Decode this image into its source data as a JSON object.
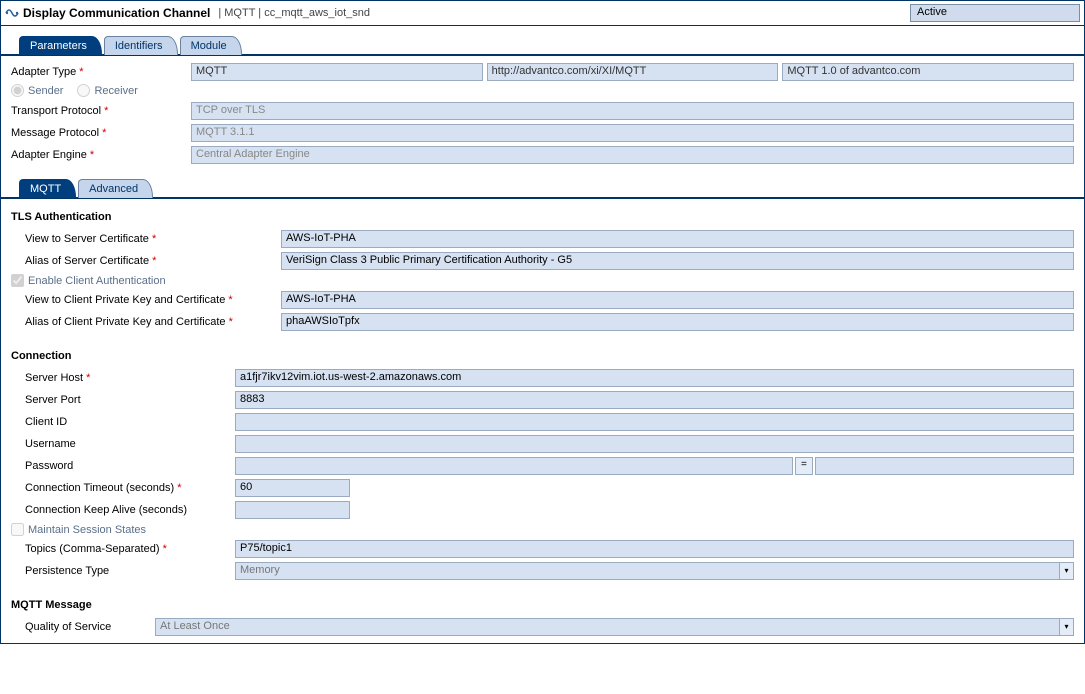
{
  "header": {
    "title": "Display Communication Channel",
    "path": "| MQTT | cc_mqtt_aws_iot_snd",
    "status": "Active"
  },
  "mainTabs": [
    {
      "label": "Parameters",
      "active": true
    },
    {
      "label": "Identifiers",
      "active": false
    },
    {
      "label": "Module",
      "active": false
    }
  ],
  "adapter": {
    "typeLabel": "Adapter Type",
    "name": "MQTT",
    "namespace": "http://advantco.com/xi/XI/MQTT",
    "component": "MQTT 1.0 of advantco.com",
    "direction": {
      "sender": "Sender",
      "receiver": "Receiver",
      "senderSelected": true
    },
    "transportLabel": "Transport Protocol",
    "transport": "TCP over TLS",
    "messageLabel": "Message Protocol",
    "message": "MQTT 3.1.1",
    "engineLabel": "Adapter Engine",
    "engine": "Central Adapter Engine"
  },
  "subTabs": [
    {
      "label": "MQTT",
      "active": true
    },
    {
      "label": "Advanced",
      "active": false
    }
  ],
  "tls": {
    "heading": "TLS Authentication",
    "viewServerLabel": "View to Server Certificate",
    "viewServer": "AWS-IoT-PHA",
    "aliasServerLabel": "Alias of Server Certificate",
    "aliasServer": "VeriSign Class 3 Public Primary Certification Authority - G5",
    "enableClientLabel": "Enable Client Authentication",
    "viewClientLabel": "View to Client Private Key and Certificate",
    "viewClient": "AWS-IoT-PHA",
    "aliasClientLabel": "Alias of Client Private Key and Certificate",
    "aliasClient": "phaAWSIoTpfx"
  },
  "connection": {
    "heading": "Connection",
    "hostLabel": "Server Host",
    "host": "a1fjr7ikv12vim.iot.us-west-2.amazonaws.com",
    "portLabel": "Server Port",
    "port": "8883",
    "clientIdLabel": "Client ID",
    "clientId": "",
    "usernameLabel": "Username",
    "username": "",
    "passwordLabel": "Password",
    "password": "",
    "timeoutLabel": "Connection Timeout (seconds)",
    "timeout": "60",
    "keepAliveLabel": "Connection Keep Alive (seconds)",
    "keepAlive": "",
    "maintainSessionLabel": "Maintain Session States",
    "topicsLabel": "Topics (Comma-Separated)",
    "topics": "P75/topic1",
    "persistenceLabel": "Persistence Type",
    "persistence": "Memory"
  },
  "mqttMessage": {
    "heading": "MQTT Message",
    "qosLabel": "Quality of Service",
    "qos": "At Least Once"
  }
}
